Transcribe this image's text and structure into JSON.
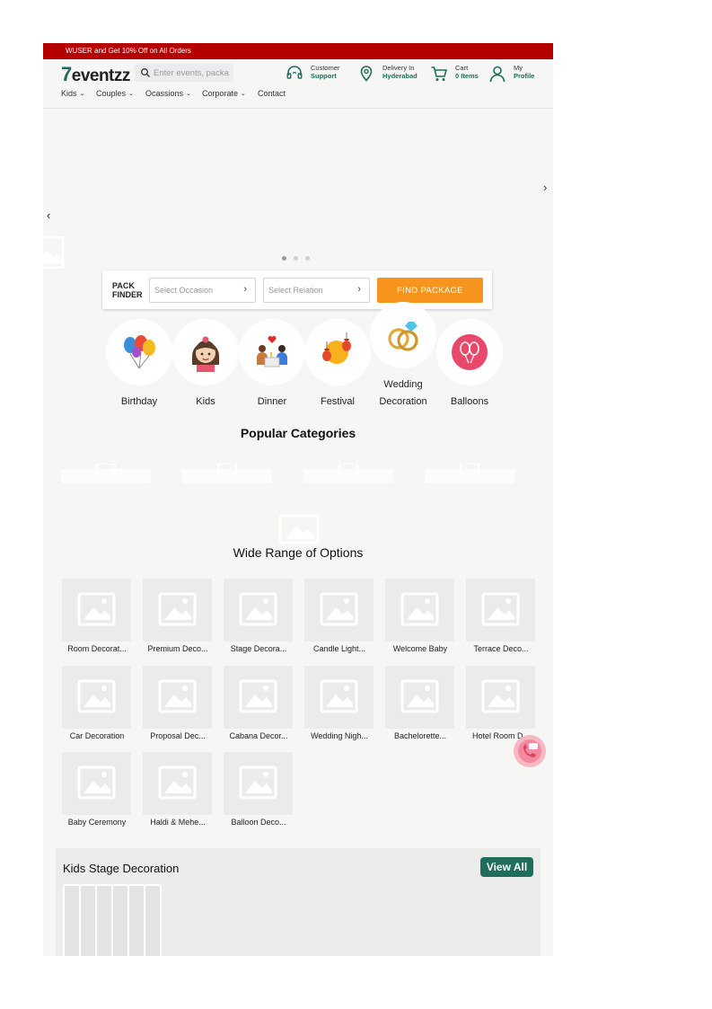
{
  "promo": {
    "text": "WUSER and Get 10% Off on All Orders"
  },
  "header": {
    "logo": {
      "seven": "7",
      "rest": "eventzz"
    },
    "search": {
      "placeholder": "Enter events, packages"
    },
    "support": {
      "line1": "Customer",
      "line2": "Support",
      "icon": "headset-icon"
    },
    "delivery": {
      "line1": "Delivery In",
      "line2": "Hyderabad",
      "icon": "location-pin-icon"
    },
    "cart": {
      "line1": "Cart",
      "line2": "0 Items",
      "icon": "cart-icon"
    },
    "profile": {
      "line1": "My",
      "line2": "Profile",
      "icon": "user-icon"
    }
  },
  "nav": {
    "items": [
      {
        "label": "Kids",
        "has_dropdown": true
      },
      {
        "label": "Couples",
        "has_dropdown": true
      },
      {
        "label": "Ocassions",
        "has_dropdown": true
      },
      {
        "label": "Corporate",
        "has_dropdown": true
      },
      {
        "label": "Contact",
        "has_dropdown": false
      }
    ]
  },
  "hero": {
    "slides": 3,
    "active_slide": 1
  },
  "pack_finder": {
    "label_line1": "PACK",
    "label_line2": "FINDER",
    "occasion_placeholder": "Select Occasion",
    "relation_placeholder": "Select Relation",
    "button": "FIND PACKAGE"
  },
  "categories": [
    {
      "label": "Birthday",
      "icon": "balloons-bunch-icon"
    },
    {
      "label": "Kids",
      "icon": "girl-face-icon"
    },
    {
      "label": "Dinner",
      "icon": "couple-dinner-icon"
    },
    {
      "label": "Festival",
      "icon": "lanterns-icon"
    },
    {
      "label": "Wedding Decoration",
      "icon": "rings-icon"
    },
    {
      "label": "Balloons",
      "icon": "balloon-circle-icon"
    }
  ],
  "popular": {
    "title": "Popular Categories"
  },
  "wide_range": {
    "title": "Wide Range of Options",
    "options": [
      "Room Decorat...",
      "Premium Deco...",
      "Stage Decora...",
      "Candle Light...",
      "Welcome Baby",
      "Terrace Deco...",
      "Car Decoration",
      "Proposal Dec...",
      "Cabana Decor...",
      "Wedding Nigh...",
      "Bachelorette...",
      "Hotel Room D...",
      "Baby Ceremony",
      "Haldi & Mehe...",
      "Balloon Deco..."
    ]
  },
  "kids_stage": {
    "title": "Kids Stage Decoration",
    "view_all": "View All"
  },
  "colors": {
    "promo_bg": "#b40000",
    "brand_green": "#1f6d5b",
    "cta_orange": "#f7941d"
  }
}
